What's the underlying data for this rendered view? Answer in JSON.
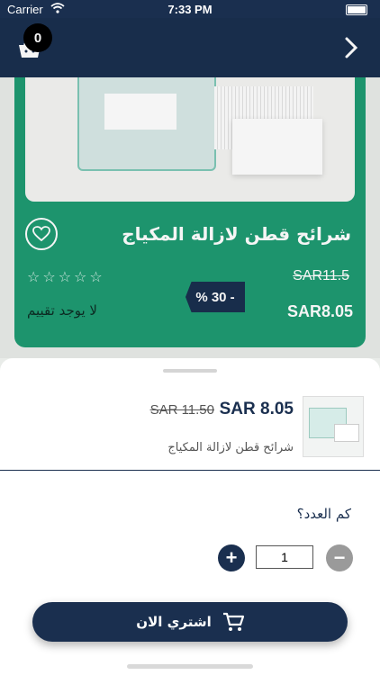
{
  "status_bar": {
    "carrier": "Carrier",
    "time": "7:33 PM"
  },
  "header": {
    "cart_count": "0"
  },
  "product_card": {
    "title": "شرائح قطن لازالة المكياج",
    "old_price": "SAR11.5",
    "new_price": "SAR8.05",
    "discount": "% 30 -",
    "rating_text": "لا يوجد تقييم",
    "stars": "☆☆☆☆☆",
    "rating_value": 0
  },
  "sheet": {
    "new_price": "SAR 8.05",
    "old_price": "SAR 11.50",
    "product_name": "شرائح قطن لازالة المكياج",
    "quantity_label": "كم العدد؟",
    "quantity_value": "1",
    "plus": "+",
    "minus": "−",
    "buy_label": "اشتري الان"
  },
  "colors": {
    "navy": "#1a2f4f",
    "green": "#1f9b72",
    "grey": "#9a9a9a"
  },
  "icons": [
    "wifi-icon",
    "cart-icon",
    "chevron-right-icon",
    "heart-icon",
    "star-icon",
    "plus-icon",
    "minus-icon",
    "shopping-cart-icon"
  ]
}
